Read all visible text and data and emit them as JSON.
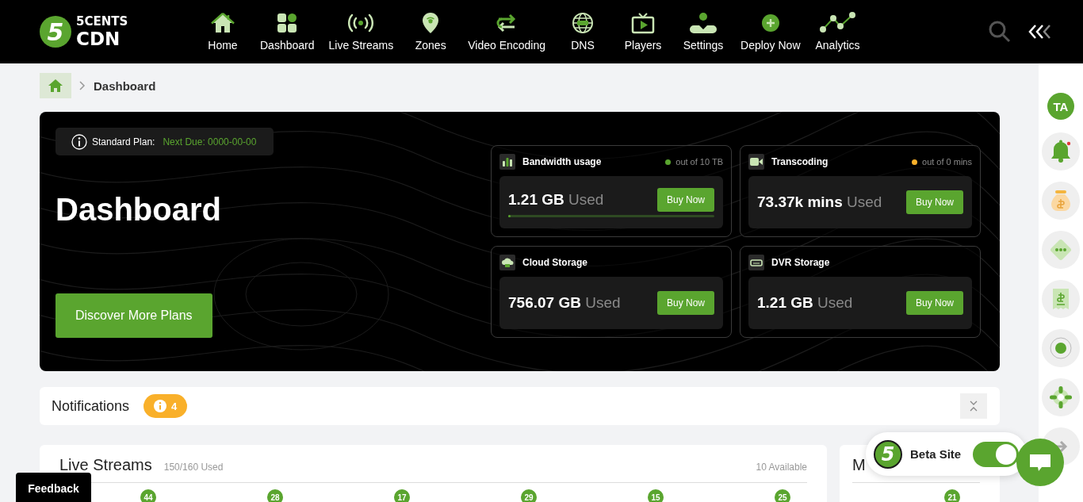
{
  "header": {
    "logo": {
      "badge": "5",
      "top": "5CENTS",
      "bottom": "CDN"
    },
    "nav": [
      {
        "label": "Home"
      },
      {
        "label": "Dashboard"
      },
      {
        "label": "Live Streams"
      },
      {
        "label": "Zones"
      },
      {
        "label": "Video Encoding"
      },
      {
        "label": "DNS"
      },
      {
        "label": "Players"
      },
      {
        "label": "Settings"
      },
      {
        "label": "Deploy Now"
      },
      {
        "label": "Analytics"
      }
    ]
  },
  "breadcrumb": {
    "current": "Dashboard"
  },
  "hero": {
    "plan": "Standard Plan:",
    "due": "Next Due: 0000-00-00",
    "title": "Dashboard",
    "button": "Discover More Plans"
  },
  "metrics": [
    {
      "title": "Bandwidth usage",
      "limit": "out of 10 TB",
      "color": "#5aa52f",
      "value": "1.21 GB",
      "unit": "Used",
      "button": "Buy Now",
      "level": 0.01
    },
    {
      "title": "Transcoding",
      "limit": "out of 0 mins",
      "color": "#f9b02a",
      "value": "73.37k mins",
      "unit": "Used",
      "button": "Buy Now"
    },
    {
      "title": "Cloud Storage",
      "value": "756.07 GB",
      "unit": "Used",
      "button": "Buy Now"
    },
    {
      "title": "DVR Storage",
      "value": "1.21 GB",
      "unit": "Used",
      "button": "Buy Now"
    }
  ],
  "notifications": {
    "title": "Notifications",
    "count": "4"
  },
  "live_streams": {
    "title": "Live Streams",
    "used": "150/160 Used",
    "available": "10 Available",
    "counts": [
      "44",
      "28",
      "17",
      "29",
      "15",
      "25"
    ]
  },
  "side_panel": {
    "title": "M",
    "counts": [
      "21"
    ]
  },
  "rail": {
    "avatar": "TA"
  },
  "feedback": "Feedback",
  "beta": {
    "badge": "5",
    "label": "Beta Site",
    "on": true
  }
}
